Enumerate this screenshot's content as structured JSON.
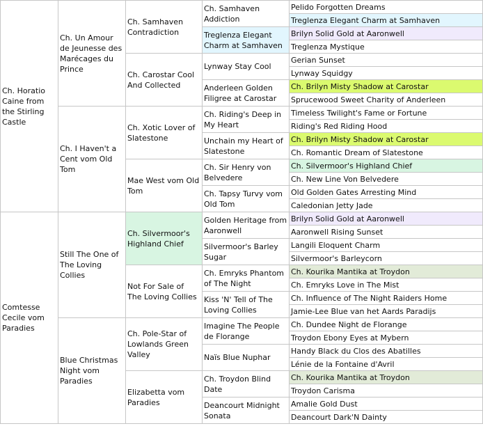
{
  "highlight_colors": {
    "blue": "#e2f6fe",
    "lavender": "#f0eafc",
    "yellow": "#dbfa6f",
    "mint": "#d8f5e2",
    "sage": "#e2ebd8"
  },
  "gen1": [
    {
      "name": "Ch. Horatio Caine from the Stirling Castle",
      "hl": ""
    },
    {
      "name": "Comtesse Cecile vom Paradies",
      "hl": ""
    }
  ],
  "gen2": [
    {
      "name": "Ch. Un Amour de Jeunesse des Marécages du Prince",
      "hl": ""
    },
    {
      "name": "Ch. I Haven't a Cent vom Old Tom",
      "hl": ""
    },
    {
      "name": "Still The One of The Loving Collies",
      "hl": ""
    },
    {
      "name": "Blue Christmas Night vom Paradies",
      "hl": ""
    }
  ],
  "gen3": [
    {
      "name": "Ch. Samhaven Contradiction",
      "hl": ""
    },
    {
      "name": "Ch. Carostar Cool And Collected",
      "hl": ""
    },
    {
      "name": "Ch. Xotic Lover of Slatestone",
      "hl": ""
    },
    {
      "name": "Mae West vom Old Tom",
      "hl": ""
    },
    {
      "name": "Ch. Silvermoor's Highland Chief",
      "hl": "mint"
    },
    {
      "name": "Not For Sale of The Loving Collies",
      "hl": ""
    },
    {
      "name": "Ch. Pole-Star of Lowlands Green Valley",
      "hl": ""
    },
    {
      "name": "Elizabetta vom Paradies",
      "hl": ""
    }
  ],
  "gen4": [
    {
      "name": "Ch. Samhaven Addiction",
      "hl": ""
    },
    {
      "name": "Treglenza Elegant Charm at Samhaven",
      "hl": "blue"
    },
    {
      "name": "Lynway Stay Cool",
      "hl": ""
    },
    {
      "name": "Anderleen Golden Filigree at Carostar",
      "hl": ""
    },
    {
      "name": "Ch. Riding's Deep in My Heart",
      "hl": ""
    },
    {
      "name": "Unchain my Heart of Slatestone",
      "hl": ""
    },
    {
      "name": "Ch. Sir Henry von Belvedere",
      "hl": ""
    },
    {
      "name": "Ch. Tapsy Turvy vom Old Tom",
      "hl": ""
    },
    {
      "name": "Golden Heritage from Aaronwell",
      "hl": ""
    },
    {
      "name": "Silvermoor's Barley Sugar",
      "hl": ""
    },
    {
      "name": "Ch. Emryks Phantom of The Night",
      "hl": ""
    },
    {
      "name": "Kiss 'N' Tell of The Loving Collies",
      "hl": ""
    },
    {
      "name": "Imagine The People de Florange",
      "hl": ""
    },
    {
      "name": "Naïs Blue Nuphar",
      "hl": ""
    },
    {
      "name": "Ch. Troydon Blind Date",
      "hl": ""
    },
    {
      "name": "Deancourt Midnight Sonata",
      "hl": ""
    }
  ],
  "gen5": [
    {
      "name": "Pelido Forgotten Dreams",
      "hl": ""
    },
    {
      "name": "Treglenza Elegant Charm at Samhaven",
      "hl": "blue"
    },
    {
      "name": "Brilyn Solid Gold at Aaronwell",
      "hl": "lavender"
    },
    {
      "name": "Treglenza Mystique",
      "hl": ""
    },
    {
      "name": "Gerian Sunset",
      "hl": ""
    },
    {
      "name": "Lynway Squidgy",
      "hl": ""
    },
    {
      "name": "Ch. Brilyn Misty Shadow at Carostar",
      "hl": "yellow"
    },
    {
      "name": "Sprucewood Sweet Charity of Anderleen",
      "hl": ""
    },
    {
      "name": "Timeless Twilight's Fame or Fortune",
      "hl": ""
    },
    {
      "name": "Riding's Red Riding Hood",
      "hl": ""
    },
    {
      "name": "Ch. Brilyn Misty Shadow at Carostar",
      "hl": "yellow"
    },
    {
      "name": "Ch. Romantic Dream of Slatestone",
      "hl": ""
    },
    {
      "name": "Ch. Silvermoor's Highland Chief",
      "hl": "mint"
    },
    {
      "name": "Ch. New Line Von Belvedere",
      "hl": ""
    },
    {
      "name": "Old Golden Gates Arresting Mind",
      "hl": ""
    },
    {
      "name": "Caledonian Jetty Jade",
      "hl": ""
    },
    {
      "name": "Brilyn Solid Gold at Aaronwell",
      "hl": "lavender"
    },
    {
      "name": "Aaronwell Rising Sunset",
      "hl": ""
    },
    {
      "name": "Langili Eloquent Charm",
      "hl": ""
    },
    {
      "name": "Silvermoor's Barleycorn",
      "hl": ""
    },
    {
      "name": "Ch. Kourika Mantika at Troydon",
      "hl": "sage"
    },
    {
      "name": "Ch. Emryks Love in The Mist",
      "hl": ""
    },
    {
      "name": "Ch. Influence of The Night Raiders Home",
      "hl": ""
    },
    {
      "name": "Jamie-Lee Blue van het Aards Paradijs",
      "hl": ""
    },
    {
      "name": "Ch. Dundee Night de Florange",
      "hl": ""
    },
    {
      "name": "Troydon Ebony Eyes at Mybern",
      "hl": ""
    },
    {
      "name": "Handy Black du Clos des Abatilles",
      "hl": ""
    },
    {
      "name": "Lénie de la Fontaine d'Avril",
      "hl": ""
    },
    {
      "name": "Ch. Kourika Mantika at Troydon",
      "hl": "sage"
    },
    {
      "name": "Troydon Carisma",
      "hl": ""
    },
    {
      "name": "Amalie Gold Dust",
      "hl": ""
    },
    {
      "name": "Deancourt Dark'N Dainty",
      "hl": ""
    }
  ]
}
